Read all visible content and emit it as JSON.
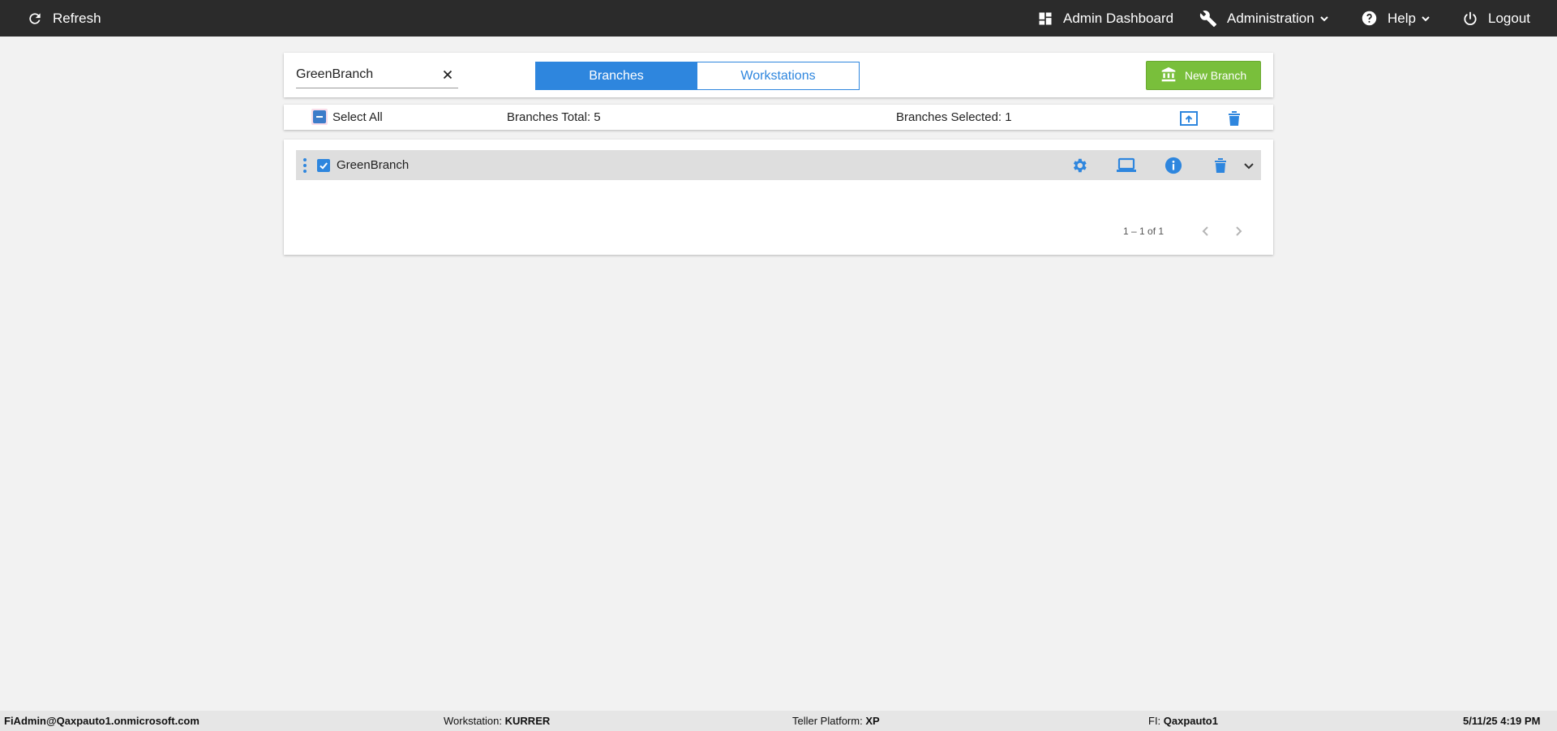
{
  "topbar": {
    "refresh_label": "Refresh",
    "admin_dashboard_label": "Admin Dashboard",
    "administration_label": "Administration",
    "help_label": "Help",
    "logout_label": "Logout"
  },
  "search": {
    "value": "GreenBranch",
    "clear_icon": "close-icon"
  },
  "tabs": [
    {
      "label": "Branches",
      "active": true
    },
    {
      "label": "Workstations",
      "active": false
    }
  ],
  "new_branch_label": "New Branch",
  "select_bar": {
    "select_all_label": "Select All",
    "branches_total": "Branches Total: 5",
    "branches_selected": "Branches Selected: 1"
  },
  "rows": [
    {
      "name": "GreenBranch",
      "checked": true
    }
  ],
  "pager": {
    "range_text": "1 – 1 of 1"
  },
  "footer": {
    "user": "FiAdmin@Qaxpauto1.onmicrosoft.com",
    "workstation_label": "Workstation:",
    "workstation_value": "KURRER",
    "teller_platform_label": "Teller Platform:",
    "teller_platform_value": "XP",
    "fi_label": "FI:",
    "fi_value": "Qaxpauto1",
    "datetime": "5/11/25 4:19 PM"
  },
  "colors": {
    "topbar_bg": "#2b2b2b",
    "primary_blue": "#2e86de",
    "new_branch_green": "#79bf3b",
    "page_bg": "#f2f2f2"
  }
}
